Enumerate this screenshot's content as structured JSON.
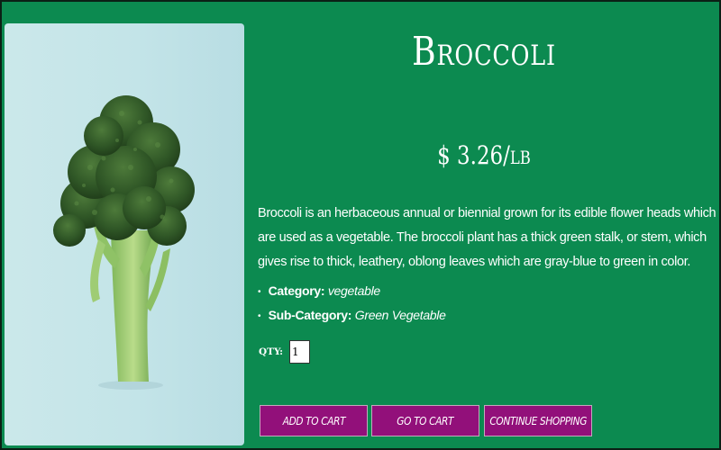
{
  "product": {
    "name": "Broccoli",
    "price": "$ 3.26/lb",
    "description": "Broccoli is an herbaceous annual or biennial grown for its edible flower heads which are used as a vegetable. The broccoli plant has a thick green stalk, or stem, which gives rise to thick, leathery, oblong leaves which are gray-blue to green in color.",
    "attributes": [
      {
        "label": "Category:",
        "value": "vegetable"
      },
      {
        "label": "Sub-Category:",
        "value": "Green Vegetable"
      }
    ]
  },
  "quantity": {
    "label": "QTY:",
    "value": "1"
  },
  "actions": {
    "add_to_cart": "Add to Cart",
    "go_to_cart": "Go to Cart",
    "continue_shopping": "Continue Shopping"
  },
  "colors": {
    "page_background": "#0c8a50",
    "button_background": "#92107a",
    "text": "#ffffff"
  },
  "image": {
    "subject": "broccoli-photo"
  }
}
